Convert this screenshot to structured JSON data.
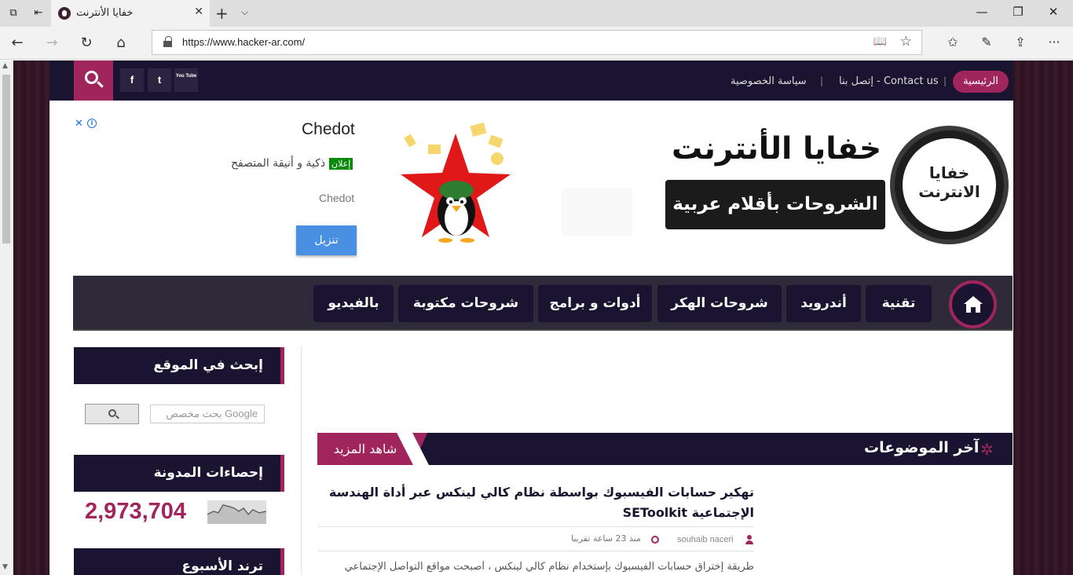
{
  "browser": {
    "tab_title": "خفايا الأنترنت",
    "url": "https://www.hacker-ar.com/"
  },
  "site": {
    "top_nav": {
      "home": "الرئيسية",
      "contact": "إتصل بنا - Contact us",
      "privacy": "سياسة الخصوصية"
    },
    "social": [
      "f",
      "t",
      "You Tube"
    ]
  },
  "ad": {
    "title": "Chedot",
    "badge": "إعلان",
    "description": "ذكية و أنيقة المتصفح",
    "subtitle": "Chedot",
    "button": "تنزيل"
  },
  "logo": {
    "title": "خفايا الأنترنت",
    "tagline": "الشروحات بأقلام عربية",
    "circle_text": "خفايا الانترنت"
  },
  "main_nav": [
    "تقنية",
    "أندرويد",
    "شروحات الهكر",
    "أدوات و برامج",
    "شروحات مكتوبة",
    "بالفيديو"
  ],
  "sidebar": {
    "search_title": "إبحث في الموقع",
    "search_placeholder": "بحث مخصص Google",
    "stats_title": "إحصاءات المدونة",
    "counter": "2,973,704",
    "trend_title": "ترند الأسبوع"
  },
  "latest": {
    "title": "آخر الموضوعات",
    "more": "شاهد المزيد",
    "post": {
      "title": "تهكير حسابات الفيسبوك بواسطة نظام كالي لينكس عبر أداة الهندسة الإجتماعية SEToolkit",
      "author": "souhaib naceri",
      "time": "منذ 23 ساعة تقريبا",
      "excerpt": "طريقة إختراق حسابات الفيسبوك بإستخدام نظام كالي لينكس ، أصبحت مواقع التواصل الإجتماعي"
    }
  },
  "colors": {
    "brand_dark": "#1b1430",
    "brand_accent": "#a1255d"
  }
}
